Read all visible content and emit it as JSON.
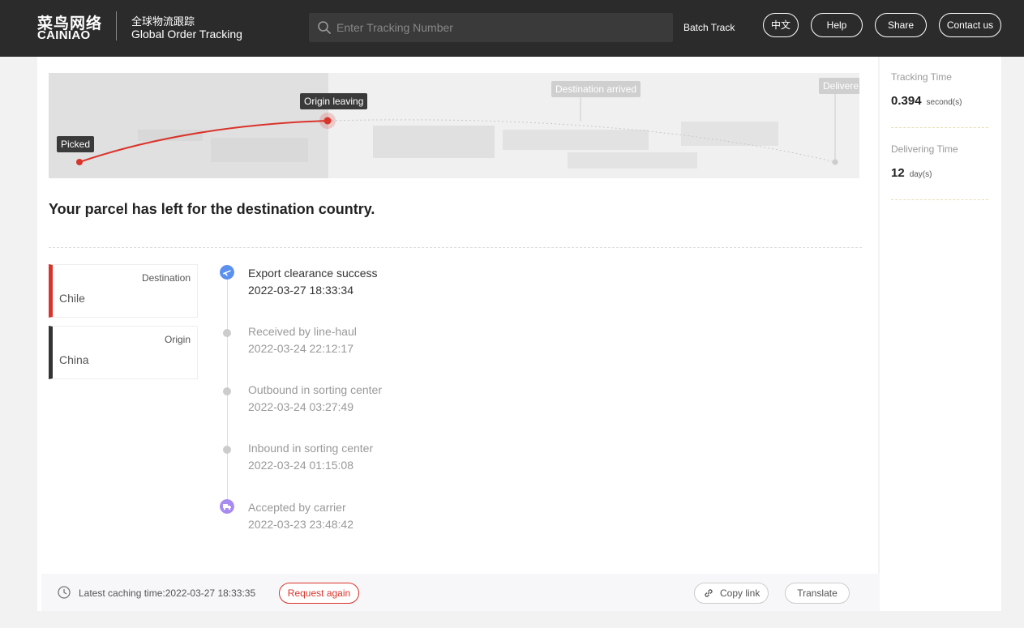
{
  "header": {
    "logo_cn": "菜鸟网络",
    "logo_en": "CAINIAO",
    "title_cn": "全球物流跟踪",
    "title_en": "Global Order Tracking",
    "search_placeholder": "Enter Tracking Number",
    "search_icon": "search-icon",
    "batch_track": "Batch Track",
    "buttons": {
      "lang": "中文",
      "help": "Help",
      "share": "Share",
      "contact": "Contact us"
    }
  },
  "map": {
    "stages": [
      "Picked",
      "Origin leaving",
      "Destination arrived",
      "Delivere"
    ],
    "current_stage": "Origin leaving",
    "progress_color": "#d9342b"
  },
  "status_message": "Your parcel has left for the destination country.",
  "locations": {
    "destination": {
      "kind": "Destination",
      "name": "Chile",
      "color": "#d9342b"
    },
    "origin": {
      "kind": "Origin",
      "name": "China",
      "color": "#333333"
    }
  },
  "timeline": [
    {
      "title": "Export clearance success",
      "time": "2022-03-27 18:33:34",
      "icon": "plane-icon",
      "active": true
    },
    {
      "title": "Received by line-haul",
      "time": "2022-03-24 22:12:17",
      "icon": "dot",
      "active": false
    },
    {
      "title": "Outbound in sorting center",
      "time": "2022-03-24 03:27:49",
      "icon": "dot",
      "active": false
    },
    {
      "title": "Inbound in sorting center",
      "time": "2022-03-24 01:15:08",
      "icon": "dot",
      "active": false
    },
    {
      "title": "Accepted by carrier",
      "time": "2022-03-23 23:48:42",
      "icon": "truck-icon",
      "active": false
    }
  ],
  "footer": {
    "cache_text": "Latest caching time:2022-03-27 18:33:35",
    "request_again": "Request again",
    "copy_link": "Copy link",
    "translate": "Translate"
  },
  "stats": {
    "tracking_time": {
      "label": "Tracking Time",
      "value": "0.394",
      "unit": "second(s)"
    },
    "delivering_time": {
      "label": "Delivering Time",
      "value": "12",
      "unit": "day(s)"
    }
  }
}
